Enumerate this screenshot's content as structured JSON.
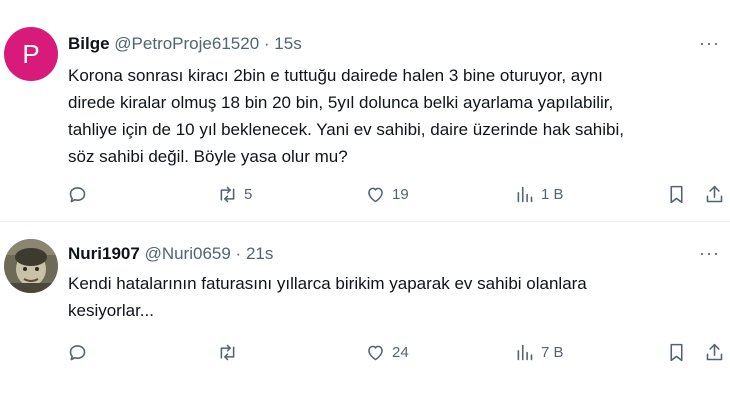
{
  "tweets": [
    {
      "avatar_letter": "P",
      "name": "Bilge",
      "handle": "@PetroProje61520",
      "separator": "·",
      "time": "15s",
      "more": "···",
      "text_lines": [
        "Korona sonrası kiracı 2bin e tuttuğu dairede halen 3 bine oturuyor, aynı",
        "direde kiralar olmuş 18 bin 20 bin, 5yıl dolunca belki ayarlama yapılabilir,",
        "tahliye için de 10 yıl beklenecek. Yani ev sahibi, daire üzerinde hak sahibi,",
        "söz sahibi değil. Böyle yasa olur mu?"
      ],
      "reply_count": "",
      "retweet_count": "5",
      "like_count": "19",
      "views_count": "1 B"
    },
    {
      "name": "Nuri1907",
      "handle": "@Nuri0659",
      "separator": "·",
      "time": "21s",
      "more": "···",
      "text_lines": [
        "Kendi hatalarının faturasını yıllarca birikim yaparak ev sahibi olanlara",
        "kesiyorlar..."
      ],
      "reply_count": "",
      "retweet_count": "",
      "like_count": "24",
      "views_count": "7 B"
    }
  ],
  "colors": {
    "avatar_p": "#d81b7a",
    "text": "#0f1419",
    "secondary": "#536471",
    "divider": "#eff3f4"
  }
}
